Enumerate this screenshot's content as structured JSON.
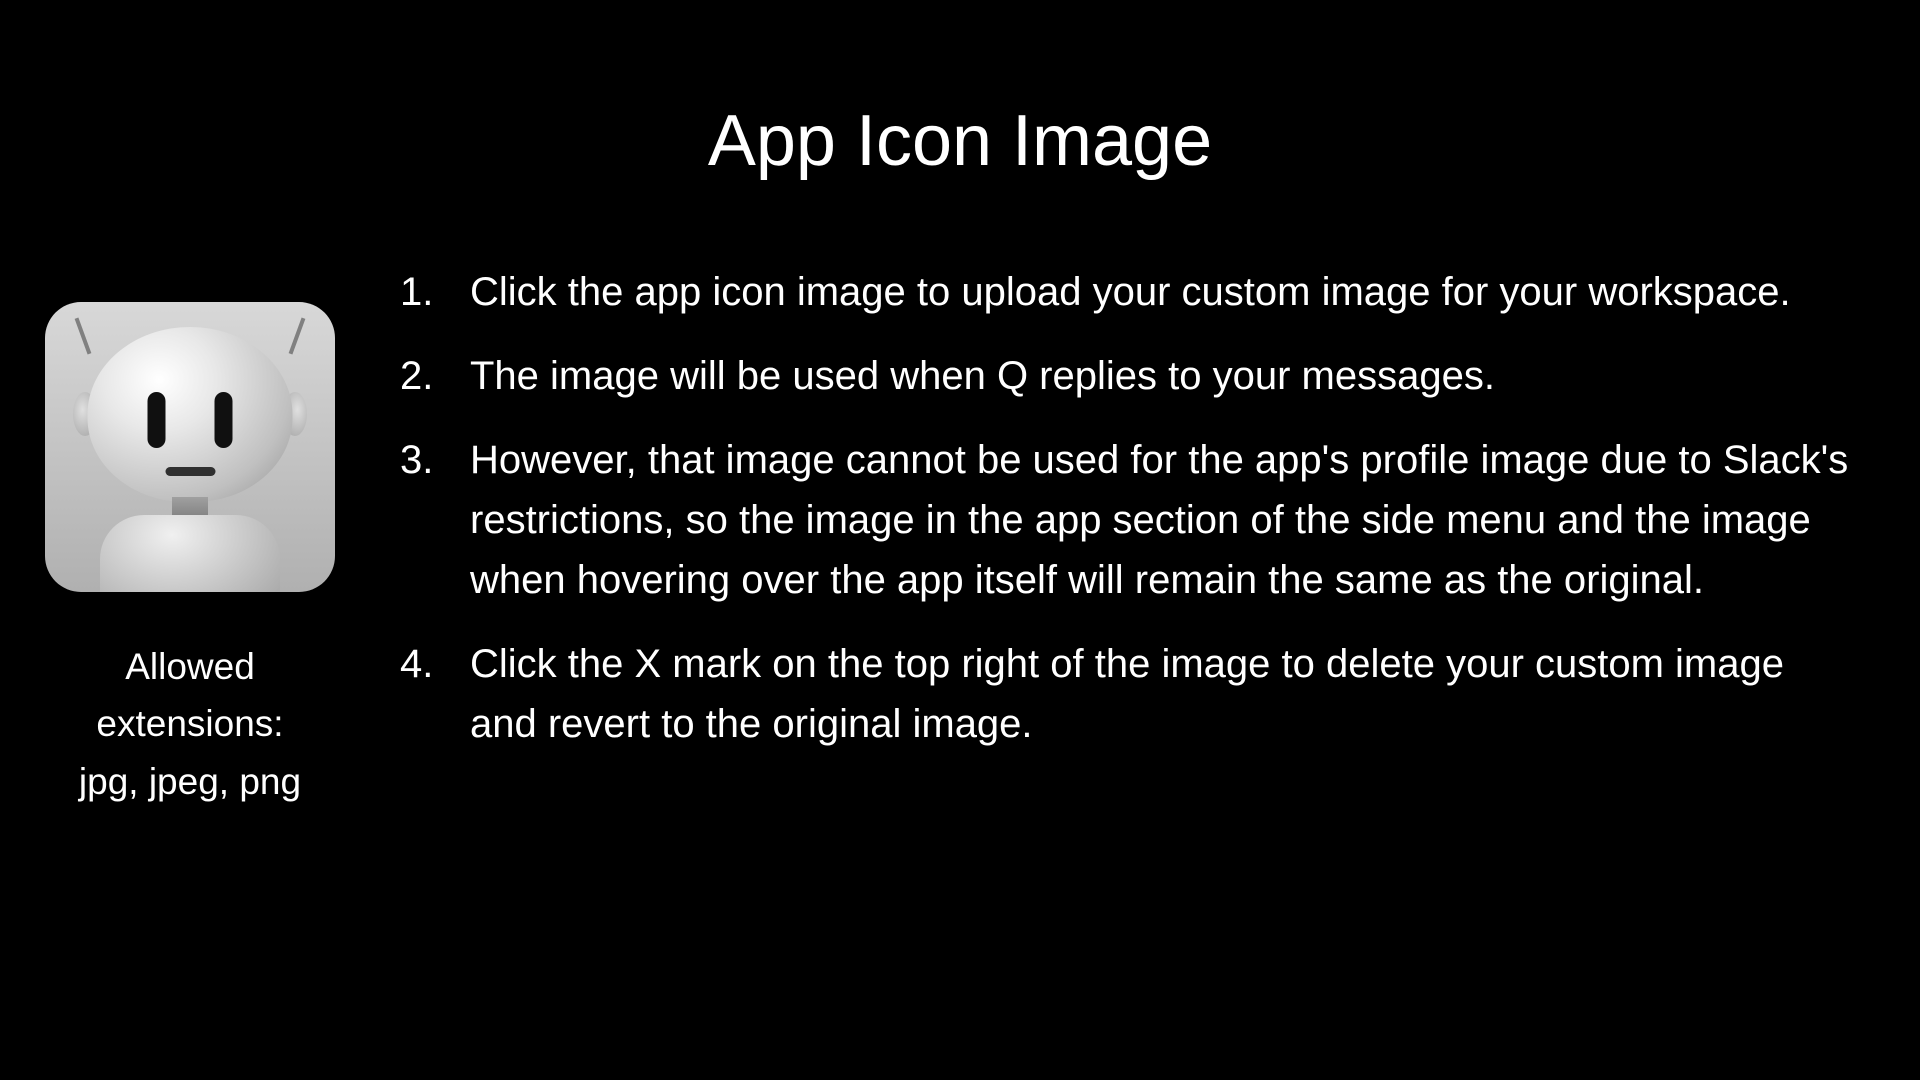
{
  "title": "App Icon Image",
  "extensions_label": "Allowed extensions:",
  "extensions_list": "jpg, jpeg, png",
  "instructions": [
    "Click the app icon image to upload your custom image for your workspace.",
    "The image will be used when Q replies to your messages.",
    "However, that image cannot be used for the app's profile image due to Slack's restrictions, so the image in the app section of the side menu and the image when hovering over the app itself will remain the same as the original.",
    "Click the X mark on the top right of the image to delete your custom image and revert to the original image."
  ]
}
